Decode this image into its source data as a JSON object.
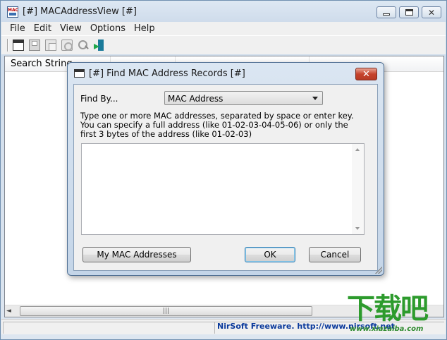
{
  "window": {
    "title": "[#] MACAddressView [#]",
    "app_icon_text": "MAC"
  },
  "menu": [
    "File",
    "Edit",
    "View",
    "Options",
    "Help"
  ],
  "toolbar": {
    "icons": [
      "window-icon",
      "save-icon",
      "copy-icon",
      "properties-icon",
      "find-icon",
      "exit-icon"
    ]
  },
  "list": {
    "columns": [
      "Search String"
    ]
  },
  "statusbar": {
    "link": "NirSoft Freeware.  http://www.nirsoft.net"
  },
  "watermark": {
    "logo": "下载吧",
    "url": "www.xiazaiba.com"
  },
  "dialog": {
    "title": "[#] Find MAC Address Records [#]",
    "find_by_label": "Find By...",
    "find_by_value": "MAC Address",
    "instructions": "Type one or more MAC addresses, separated by space or enter key. You can specify a full address (like 01-02-03-04-05-06) or only the first 3 bytes of the address (like 01-02-03)",
    "textarea_value": "",
    "buttons": {
      "my_mac": "My MAC Addresses",
      "ok": "OK",
      "cancel": "Cancel"
    }
  },
  "colors": {
    "titlebar": "#dbe6f2",
    "close_button": "#c6432d",
    "status_link": "#0b3a9c",
    "watermark": "#2d9b2d"
  }
}
